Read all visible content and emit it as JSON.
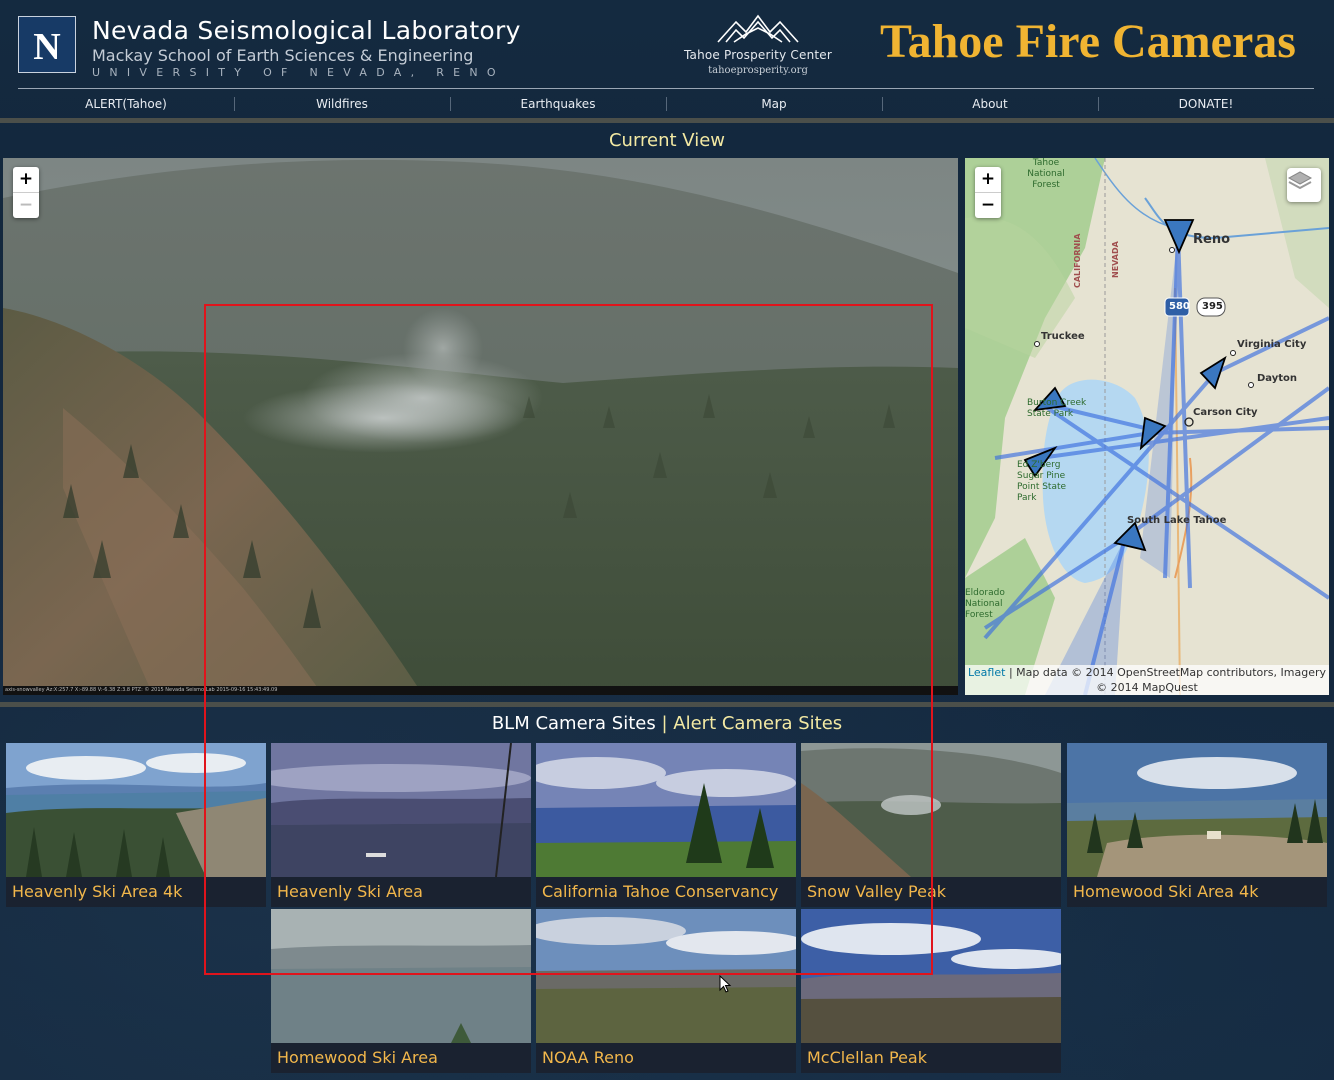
{
  "header": {
    "org_title": "Nevada Seismological Laboratory",
    "org_subtitle": "Mackay School of Earth Sciences & Engineering",
    "university": "UNIVERSITY OF NEVADA, RENO",
    "logo_letter": "N",
    "partner_name": "Tahoe Prosperity Center",
    "partner_url": "tahoeprosperity.org",
    "site_title": "Tahoe Fire Cameras"
  },
  "nav": {
    "items": [
      {
        "label": "ALERT(Tahoe)"
      },
      {
        "label": "Wildfires"
      },
      {
        "label": "Earthquakes"
      },
      {
        "label": "Map"
      },
      {
        "label": "About"
      },
      {
        "label": "DONATE!"
      }
    ]
  },
  "current_view": {
    "title": "Current View",
    "caption": "axis-snowvalley Az:X:257.7 X:-89.88 V:-6.38 Z:3.8 PTZ: © 2015 Nevada Seismo Lab 2015-09-16 15:43:49.09",
    "zoom_in": "+",
    "zoom_out": "−"
  },
  "map": {
    "zoom_in": "+",
    "zoom_out": "−",
    "labels": {
      "forest": "Tahoe National Forest",
      "reno": "Reno",
      "california": "CALIFORNIA",
      "nevada": "NEVADA",
      "i580": "580",
      "us395": "395",
      "truckee": "Truckee",
      "virginia_city": "Virginia City",
      "dayton": "Dayton",
      "carson_city": "Carson City",
      "burton_park": "Burton Creek State Park",
      "sugar_pine": "Ed Z'berg Sugar Pine Point State Park",
      "south_lake": "South Lake Tahoe",
      "eldorado": "Eldorado National Forest"
    },
    "attribution_link": "Leaflet",
    "attribution_text": "| Map data © 2014 OpenStreetMap contributors, Imagery © 2014 MapQuest"
  },
  "sites": {
    "blm_label": "BLM Camera Sites",
    "separator": "|",
    "alert_label": "Alert Camera Sites",
    "tiles": [
      {
        "label": "Heavenly Ski Area 4k"
      },
      {
        "label": "Heavenly Ski Area"
      },
      {
        "label": "California Tahoe Conservancy"
      },
      {
        "label": "Snow Valley Peak"
      },
      {
        "label": "Homewood Ski Area 4k"
      },
      {
        "label": "Homewood Ski Area"
      },
      {
        "label": "NOAA Reno"
      },
      {
        "label": "McClellan Peak"
      }
    ]
  },
  "colors": {
    "accent_gold": "#f0b432",
    "highlight_yellow": "#f3e9a3",
    "tile_label": "#f2b74b",
    "selection_red": "#e0141c",
    "background": "#13263b"
  }
}
